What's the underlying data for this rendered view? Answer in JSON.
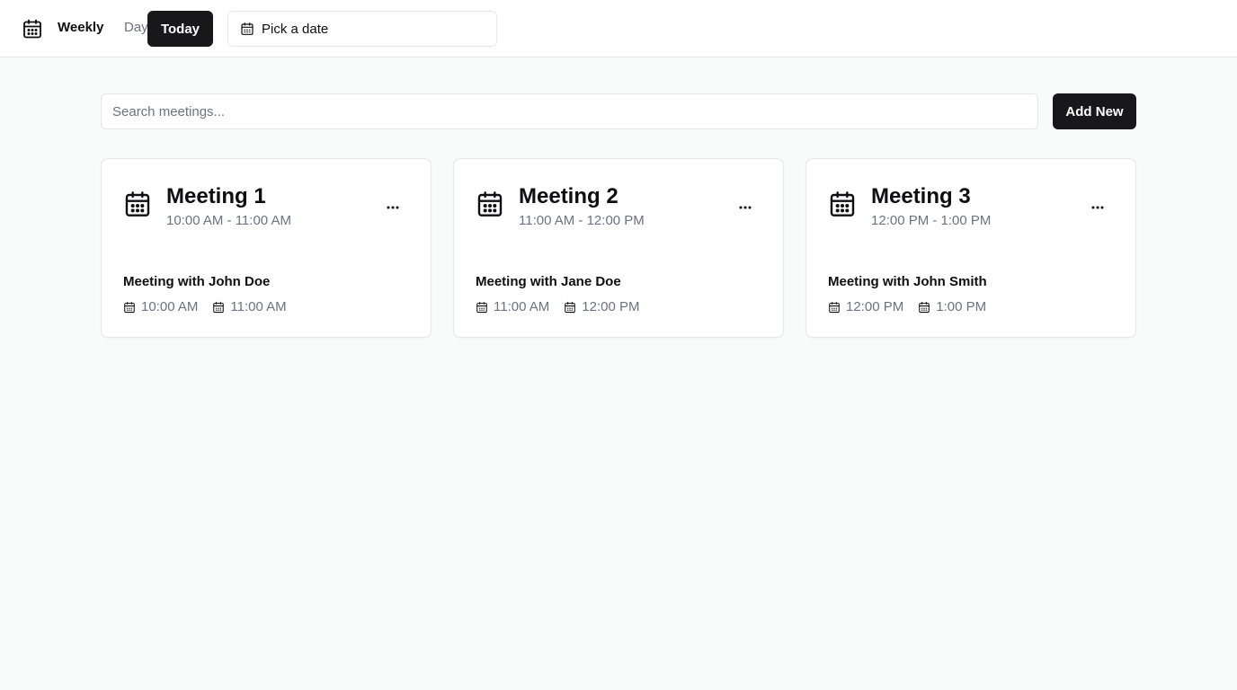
{
  "header": {
    "brand_icon": "calendar-icon",
    "view_weekly": "Weekly",
    "view_day": "Day",
    "today_label": "Today",
    "date_picker_label": "Pick a date"
  },
  "toolbar": {
    "search_placeholder": "Search meetings...",
    "add_label": "Add New"
  },
  "meetings": [
    {
      "title": "Meeting 1",
      "time_range": "10:00 AM - 11:00 AM",
      "description": "Meeting with John Doe",
      "start": "10:00 AM",
      "end": "11:00 AM"
    },
    {
      "title": "Meeting 2",
      "time_range": "11:00 AM - 12:00 PM",
      "description": "Meeting with Jane Doe",
      "start": "11:00 AM",
      "end": "12:00 PM"
    },
    {
      "title": "Meeting 3",
      "time_range": "12:00 PM - 1:00 PM",
      "description": "Meeting with John Smith",
      "start": "12:00 PM",
      "end": "1:00 PM"
    }
  ],
  "colors": {
    "primary": "#18181b",
    "muted_text": "#6b7280",
    "border": "#e5e7eb",
    "background": "#f9fafa"
  }
}
